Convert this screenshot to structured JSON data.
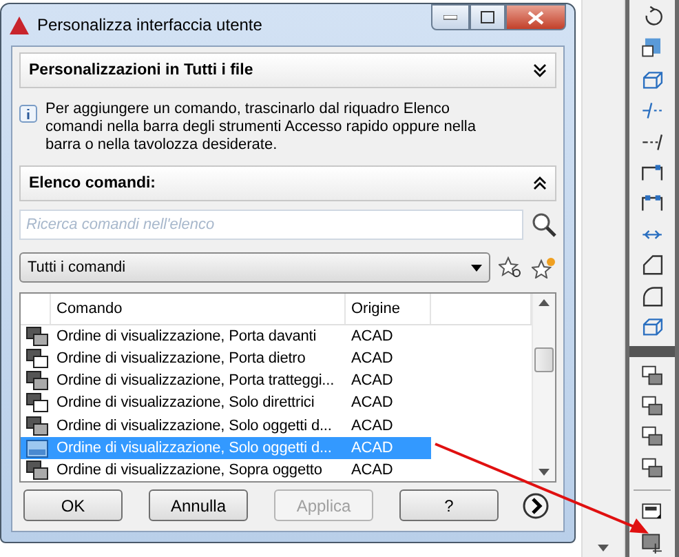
{
  "window": {
    "title": "Personalizza interfaccia utente"
  },
  "customizations_header": {
    "label": "Personalizzazioni in Tutti i file",
    "expanded": false
  },
  "info_text": "Per aggiungere un comando, trascinarlo dal riquadro Elenco comandi nella barra degli strumenti Accesso rapido oppure nella barra o nella tavolozza desiderate.",
  "commands_header": {
    "label": "Elenco comandi:",
    "expanded": true
  },
  "search": {
    "placeholder": "Ricerca comandi nell'elenco"
  },
  "filter": {
    "value": "Tutti i comandi"
  },
  "table": {
    "columns": [
      "Comando",
      "Origine"
    ],
    "rows": [
      {
        "command": "Ordine di visualizzazione, Porta davanti",
        "origin": "ACAD",
        "selected": false
      },
      {
        "command": "Ordine di visualizzazione, Porta dietro",
        "origin": "ACAD",
        "selected": false
      },
      {
        "command": "Ordine di visualizzazione, Porta tratteggi...",
        "origin": "ACAD",
        "selected": false
      },
      {
        "command": "Ordine di visualizzazione, Solo direttrici",
        "origin": "ACAD",
        "selected": false
      },
      {
        "command": "Ordine di visualizzazione, Solo oggetti d...",
        "origin": "ACAD",
        "selected": false
      },
      {
        "command": "Ordine di visualizzazione, Solo oggetti d...",
        "origin": "ACAD",
        "selected": true
      },
      {
        "command": "Ordine di visualizzazione, Sopra oggetto",
        "origin": "ACAD",
        "selected": false
      }
    ]
  },
  "buttons": [
    {
      "label": "OK",
      "disabled": false
    },
    {
      "label": "Annulla",
      "disabled": false
    },
    {
      "label": "Applica",
      "disabled": true
    },
    {
      "label": "?",
      "disabled": false
    }
  ]
}
